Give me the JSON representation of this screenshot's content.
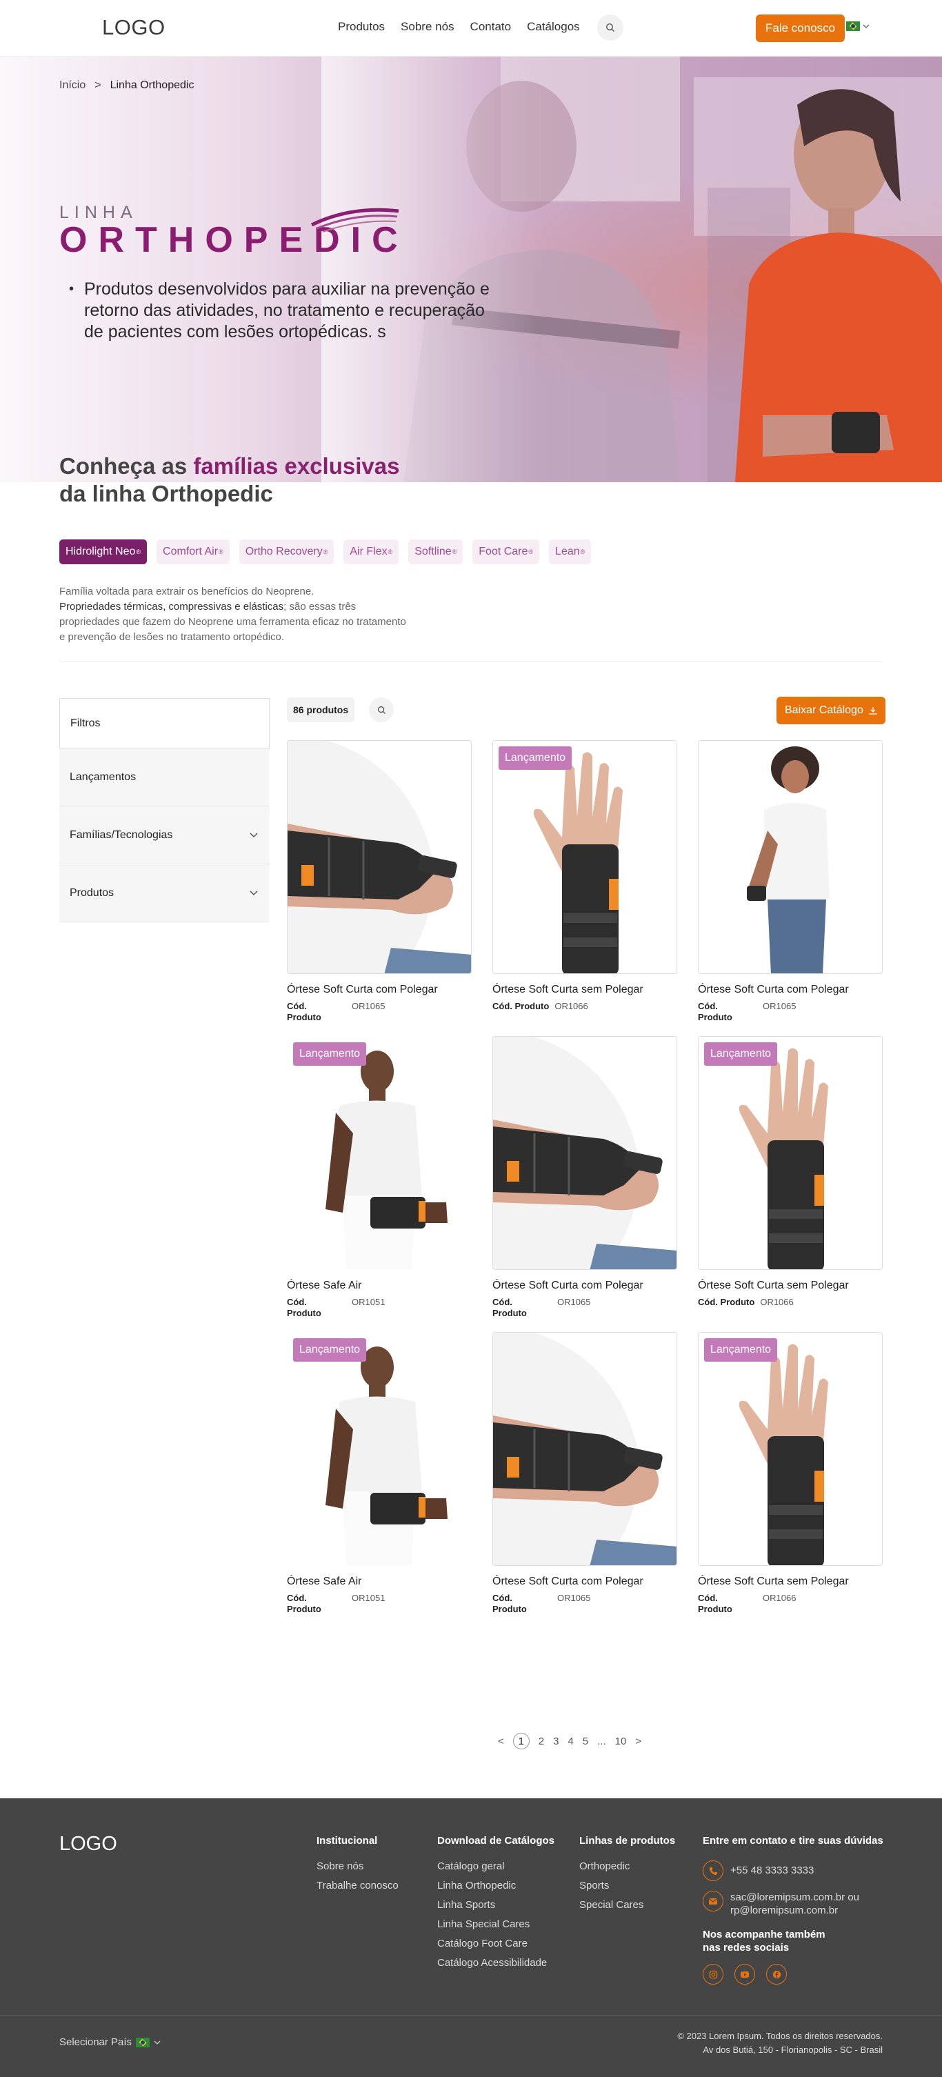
{
  "header": {
    "logo": "LOGO",
    "nav": [
      "Produtos",
      "Sobre nós",
      "Contato",
      "Catálogos"
    ],
    "cta": "Fale conosco"
  },
  "breadcrumb": {
    "home": "Início",
    "sep": ">",
    "current": "Linha Orthopedic"
  },
  "hero": {
    "linha": "LINHA",
    "orthopedic": "ORTHOPEDIC",
    "text": "Produtos desenvolvidos para auxiliar na prevenção e retorno das atividades, no tratamento e recuperação de pacientes com lesões ortopédicas. s"
  },
  "families": {
    "title_pre": "Conheça as ",
    "title_bold": "famílias exclusivas",
    "title_line2": "da linha Orthopedic",
    "chips": [
      {
        "label": "Hidrolight Neo",
        "active": true
      },
      {
        "label": "Comfort Air"
      },
      {
        "label": "Ortho Recovery"
      },
      {
        "label": "Air Flex"
      },
      {
        "label": "Softline"
      },
      {
        "label": "Foot Care"
      },
      {
        "label": "Lean"
      }
    ],
    "chip_mark": "®",
    "desc_1": "Família voltada para extrair os benefícios do Neoprene.",
    "desc_2_bold": "Propriedades térmicas, compressivas e elásticas",
    "desc_2_rest": "; são essas três propriedades que fazem do Neoprene uma ferramenta eficaz no tratamento e prevenção de lesões no tratamento ortopédico."
  },
  "filters": {
    "title": "Filtros",
    "items": [
      "Lançamentos",
      "Famílias/Tecnologias",
      "Produtos"
    ]
  },
  "toolbar": {
    "count": "86 produtos",
    "download": "Baixar Catálogo"
  },
  "products": {
    "badge": "Lançamento",
    "code_label": "Cód. Produto",
    "items": [
      {
        "name": "Órtese Soft Curta com Polegar",
        "code": "OR1065",
        "isNew": false,
        "img": "arm",
        "inline": false
      },
      {
        "name": "Órtese Soft Curta sem Polegar",
        "code": "OR1066",
        "isNew": true,
        "img": "hand",
        "inline": true
      },
      {
        "name": "Órtese Soft Curta com Polegar",
        "code": "OR1065",
        "isNew": false,
        "img": "woman",
        "inline": false
      },
      {
        "name": "Órtese Safe Air",
        "code": "OR1051",
        "isNew": true,
        "img": "man",
        "inline": false
      },
      {
        "name": "Órtese Soft Curta com Polegar",
        "code": "OR1065",
        "isNew": false,
        "img": "arm",
        "inline": false
      },
      {
        "name": "Órtese Soft Curta sem Polegar",
        "code": "OR1066",
        "isNew": true,
        "img": "hand",
        "inline": true
      },
      {
        "name": "Órtese Safe Air",
        "code": "OR1051",
        "isNew": true,
        "img": "man",
        "inline": false
      },
      {
        "name": "Órtese Soft Curta com Polegar",
        "code": "OR1065",
        "isNew": false,
        "img": "arm",
        "inline": false
      },
      {
        "name": "Órtese Soft Curta sem Polegar",
        "code": "OR1066",
        "isNew": true,
        "img": "hand",
        "inline": false
      }
    ]
  },
  "pagination": {
    "prev": "<",
    "pages": [
      "1",
      "2",
      "3",
      "4",
      "5",
      "...",
      "10"
    ],
    "next": ">",
    "current": "1"
  },
  "footer": {
    "logo": "LOGO",
    "institucional": {
      "title": "Institucional",
      "links": [
        "Sobre nós",
        "Trabalhe conosco"
      ]
    },
    "catalogos": {
      "title": "Download de Catálogos",
      "links": [
        "Catálogo geral",
        "Linha Orthopedic",
        "Linha Sports",
        "Linha Special Cares",
        "Catálogo Foot Care",
        "Catálogo Acessibilidade"
      ]
    },
    "linhas": {
      "title": "Linhas de produtos",
      "links": [
        "Orthopedic",
        "Sports",
        "Special Cares"
      ]
    },
    "contato": {
      "title": "Entre em contato e tire suas dúvidas",
      "phone": "+55 48 3333 3333",
      "email": "sac@loremipsum.com.br ou rp@loremipsum.com.br",
      "social_title": "Nos acompanhe também nas redes sociais"
    },
    "country": "Selecionar País",
    "copyright": "©  2023 Lorem Ipsum. Todos os direitos reservados.",
    "address": "Av dos Butiá, 150 - Florianopolis - SC - Brasil"
  },
  "colors": {
    "accent": "#e8730d",
    "brand": "#87236e",
    "badge": "#c479b8",
    "footer": "#454545"
  }
}
